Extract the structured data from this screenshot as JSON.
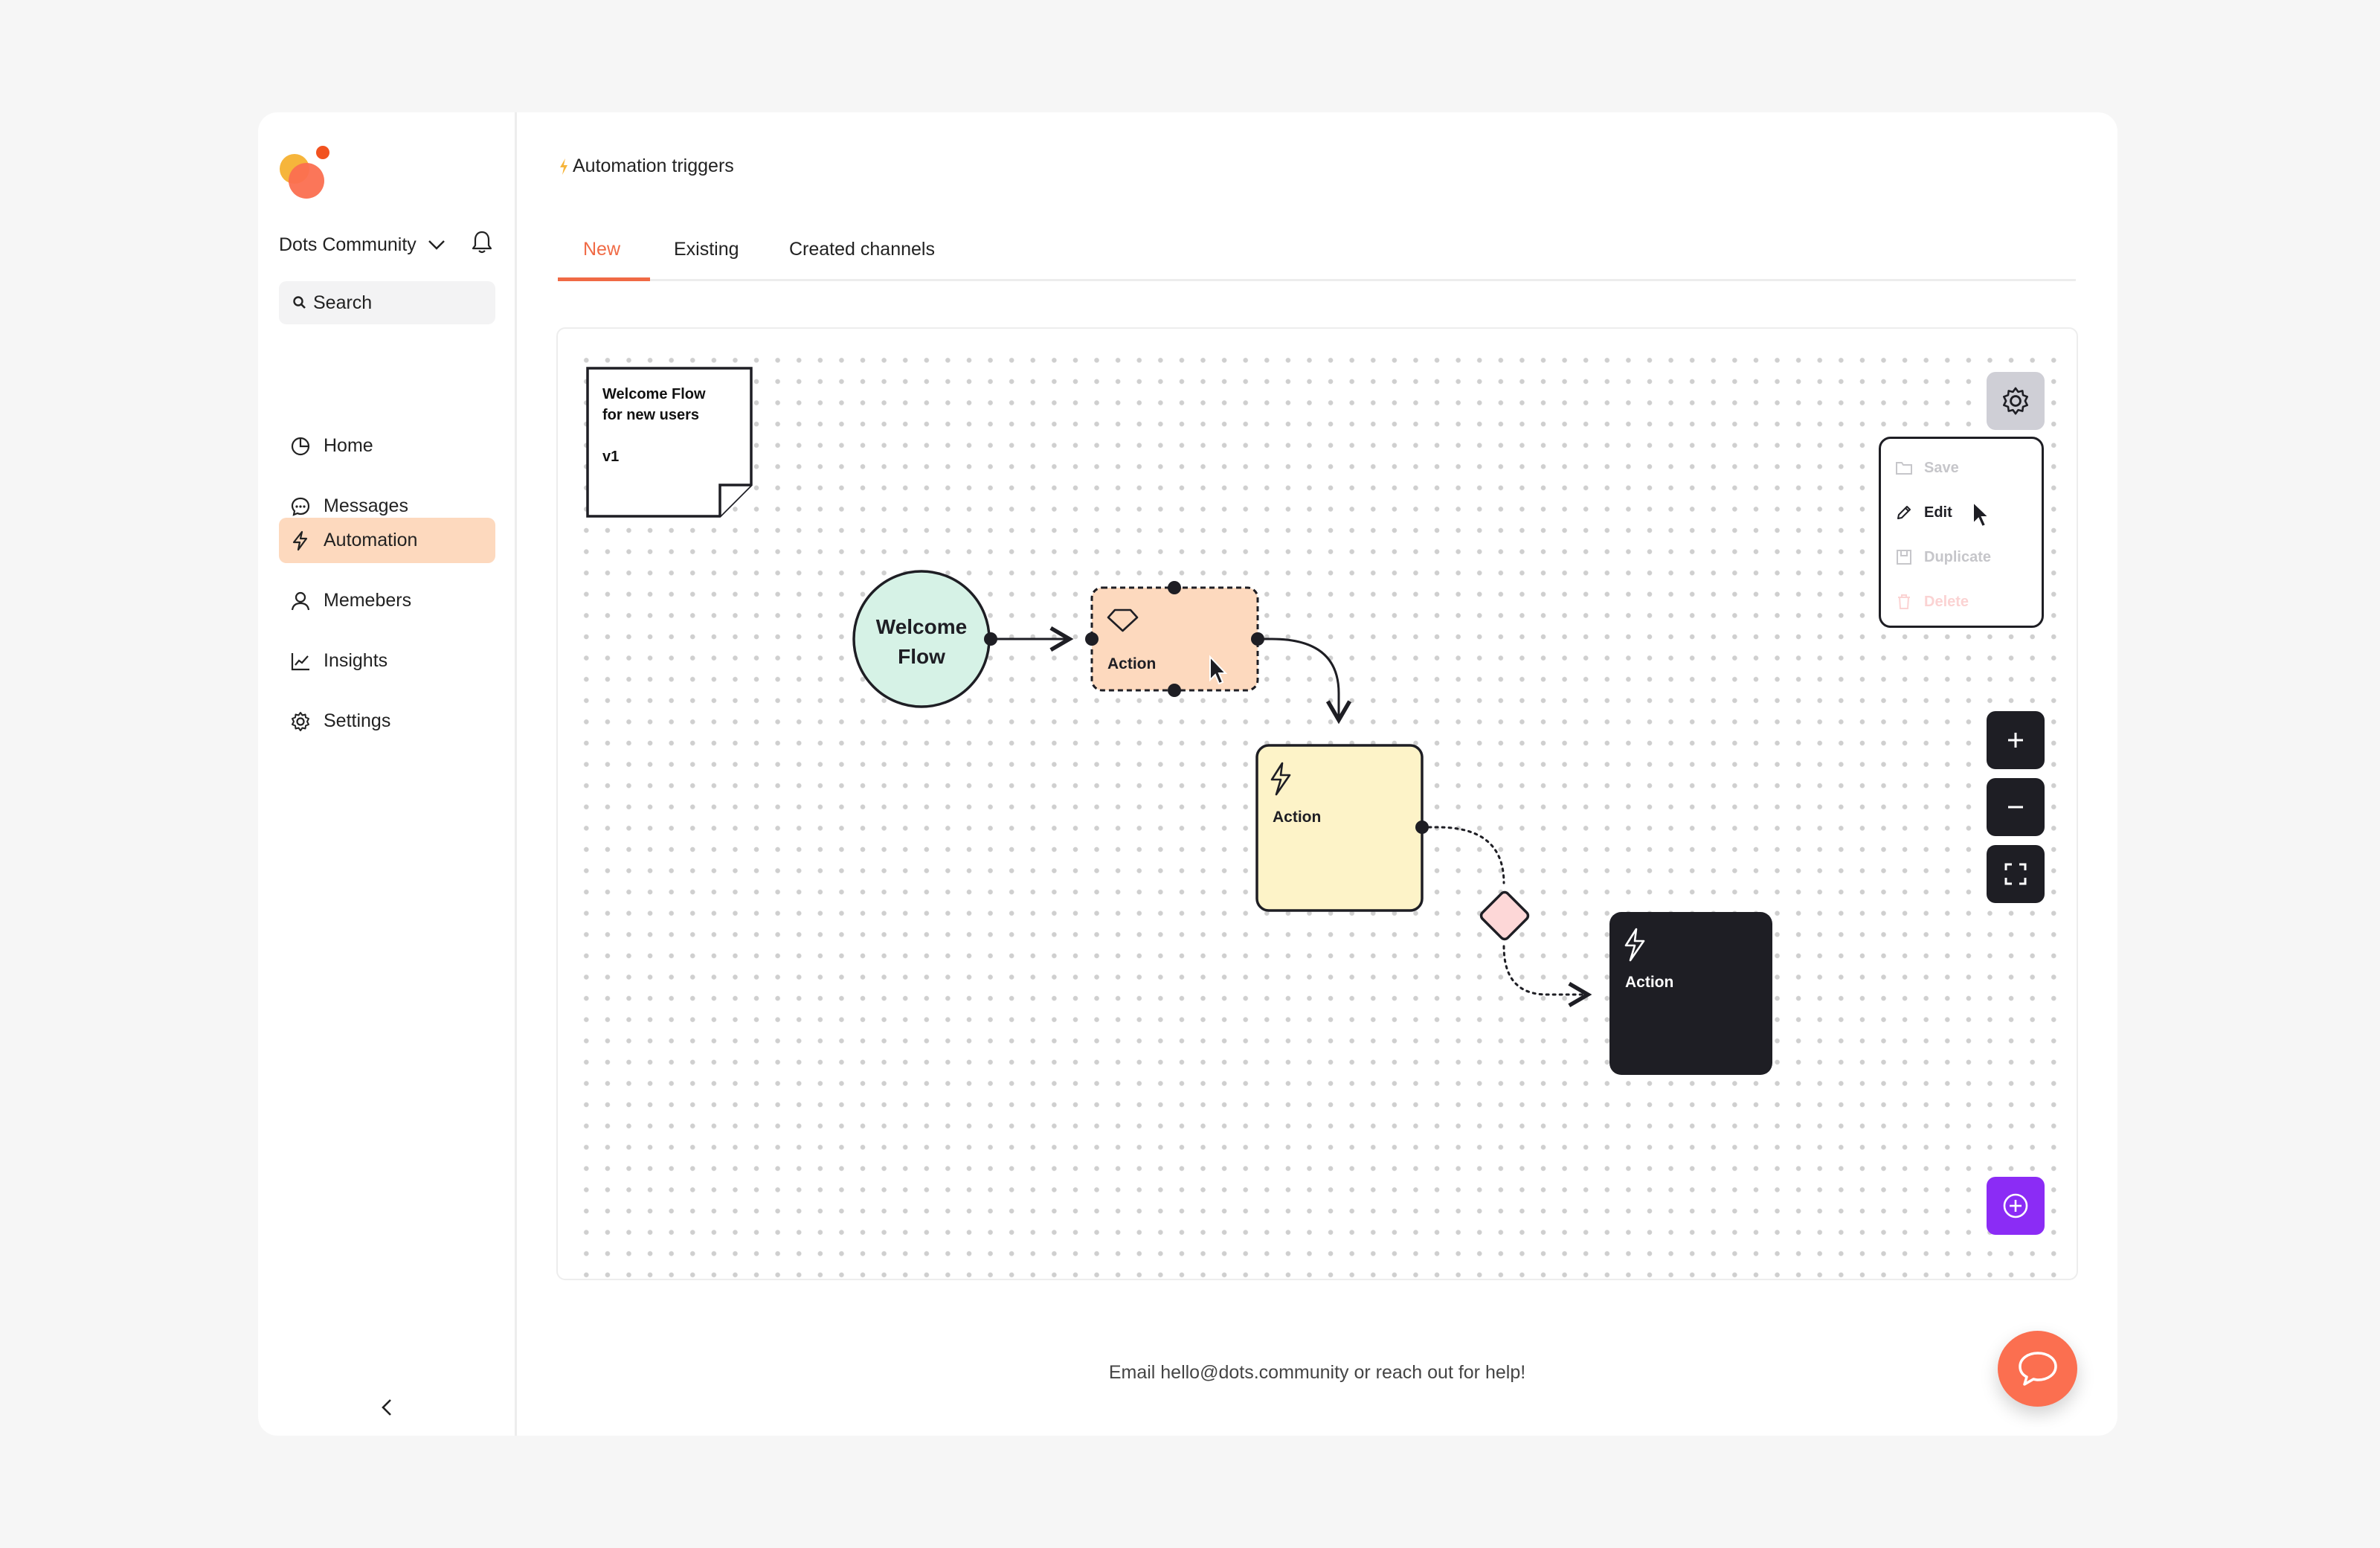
{
  "sidebar": {
    "community_name": "Dots Community",
    "search_placeholder": "Search",
    "items": [
      {
        "label": "Home",
        "icon": "pie-chart-icon"
      },
      {
        "label": "Messages",
        "icon": "chat-bubble-icon"
      },
      {
        "label": "Automation",
        "icon": "bolt-icon",
        "active": true
      },
      {
        "label": "Memebers",
        "icon": "user-icon"
      },
      {
        "label": "Insights",
        "icon": "line-chart-icon"
      },
      {
        "label": "Settings",
        "icon": "gear-icon"
      }
    ]
  },
  "header": {
    "title": "Automation triggers",
    "tabs": [
      {
        "label": "New",
        "active": true
      },
      {
        "label": "Existing"
      },
      {
        "label": "Created channels"
      }
    ]
  },
  "canvas": {
    "note": {
      "line1": "Welcome Flow",
      "line2": "for new users",
      "version": "v1"
    },
    "start_node": {
      "line1": "Welcome",
      "line2": "Flow"
    },
    "nodes": [
      {
        "label": "Action",
        "icon": "gem-icon",
        "color": "#fdd9be",
        "selected": true
      },
      {
        "label": "Action",
        "icon": "bolt-icon",
        "color": "#fdf3c8"
      },
      {
        "label": "Action",
        "icon": "bolt-icon",
        "color": "#1e1e24"
      }
    ],
    "condition_color": "#fdd7d7",
    "menu": {
      "items": [
        {
          "label": "Save",
          "icon": "folder-icon",
          "state": "disabled"
        },
        {
          "label": "Edit",
          "icon": "pencil-icon",
          "state": "enabled"
        },
        {
          "label": "Duplicate",
          "icon": "duplicate-icon",
          "state": "disabled"
        },
        {
          "label": "Delete",
          "icon": "trash-icon",
          "state": "disabled-destructive"
        }
      ]
    }
  },
  "footer": {
    "help_text": "Email hello@dots.community or reach out for help!"
  },
  "colors": {
    "accent": "#f06a45",
    "active_nav": "#fdd9be",
    "add_button": "#8b2cf5",
    "chat_button": "#fb6f50",
    "dark": "#1e1e24"
  }
}
